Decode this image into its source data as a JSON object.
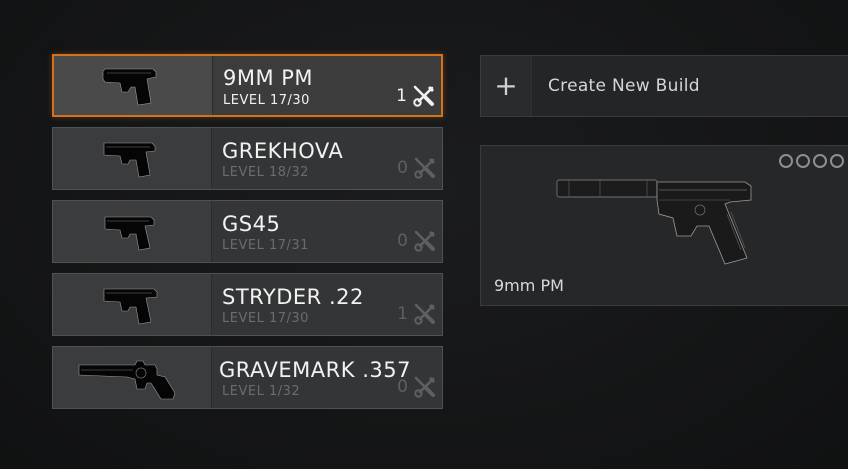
{
  "weapons": [
    {
      "name": "9MM PM",
      "level": "LEVEL 17/30",
      "builds": "1",
      "selected": true,
      "icon": "pistol-9mm-pm-icon"
    },
    {
      "name": "GREKHOVA",
      "level": "LEVEL 18/32",
      "builds": "0",
      "selected": false,
      "icon": "pistol-grekhova-icon"
    },
    {
      "name": "GS45",
      "level": "LEVEL 17/31",
      "builds": "0",
      "selected": false,
      "icon": "pistol-gs45-icon"
    },
    {
      "name": "STRYDER .22",
      "level": "LEVEL 17/30",
      "builds": "1",
      "selected": false,
      "icon": "pistol-stryder-icon"
    },
    {
      "name": "GRAVEMARK .357",
      "level": "LEVEL 1/32",
      "builds": "0",
      "selected": false,
      "icon": "revolver-gravemark-icon"
    }
  ],
  "create_build": {
    "icon": "plus-icon",
    "label": "Create New Build"
  },
  "build_preview": {
    "name": "9mm PM",
    "attachment_slots": 4,
    "image": "suppressed-pistol-image"
  },
  "colors": {
    "selected_border": "#d2711e",
    "card_bg": "#343536",
    "text_primary": "#f2f2f2",
    "text_muted": "#6b6c6d"
  }
}
